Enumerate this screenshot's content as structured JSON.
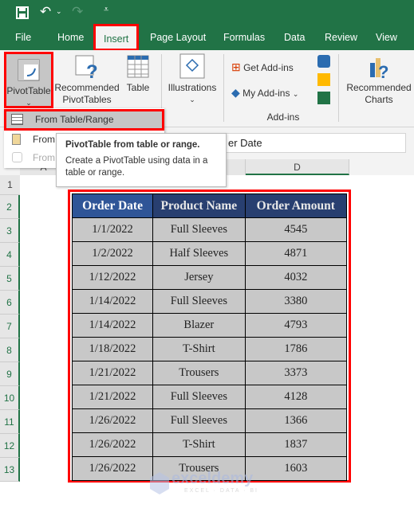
{
  "quick_access": {
    "save": "save-icon",
    "undo": "undo-icon",
    "redo": "redo-icon",
    "customize": "customize-icon"
  },
  "tabs": [
    "File",
    "Home",
    "Insert",
    "Page Layout",
    "Formulas",
    "Data",
    "Review",
    "View"
  ],
  "active_tab": "Insert",
  "ribbon": {
    "pivottable": "PivotTable",
    "recommended_pivot_1": "Recommended",
    "recommended_pivot_2": "PivotTables",
    "table": "Table",
    "illustrations": "Illustrations",
    "get_addins": "Get Add-ins",
    "my_addins": "My Add-ins",
    "addins_group": "Add-ins",
    "recommended_charts_1": "Recommended",
    "recommended_charts_2": "Charts"
  },
  "menu": {
    "items": [
      "From Table/Range",
      "From",
      "From"
    ]
  },
  "tooltip": {
    "title": "PivotTable from table or range.",
    "body": "Create a PivotTable using data in a table or range."
  },
  "formula_bar": "er Date",
  "columns": [
    "A",
    "D"
  ],
  "rows": [
    "1",
    "2",
    "3",
    "4",
    "5",
    "6",
    "7",
    "8",
    "9",
    "10",
    "11",
    "12",
    "13"
  ],
  "table": {
    "headers": [
      "Order Date",
      "Product Name",
      "Order Amount"
    ],
    "rows": [
      [
        "1/1/2022",
        "Full Sleeves",
        "4545"
      ],
      [
        "1/2/2022",
        "Half Sleeves",
        "4871"
      ],
      [
        "1/12/2022",
        "Jersey",
        "4032"
      ],
      [
        "1/14/2022",
        "Full Sleeves",
        "3380"
      ],
      [
        "1/14/2022",
        "Blazer",
        "4793"
      ],
      [
        "1/18/2022",
        "T-Shirt",
        "1786"
      ],
      [
        "1/21/2022",
        "Trousers",
        "3373"
      ],
      [
        "1/21/2022",
        "Full Sleeves",
        "4128"
      ],
      [
        "1/26/2022",
        "Full Sleeves",
        "1366"
      ],
      [
        "1/26/2022",
        "T-Shirt",
        "1837"
      ],
      [
        "1/26/2022",
        "Trousers",
        "1603"
      ]
    ]
  },
  "watermark": {
    "name": "exceldemy",
    "tagline": "EXCEL · DATA · BI"
  },
  "colors": {
    "excel_green": "#217346",
    "highlight": "#ff0000",
    "header_blue": "#283f70",
    "cell_gray": "#c8c8c8"
  }
}
